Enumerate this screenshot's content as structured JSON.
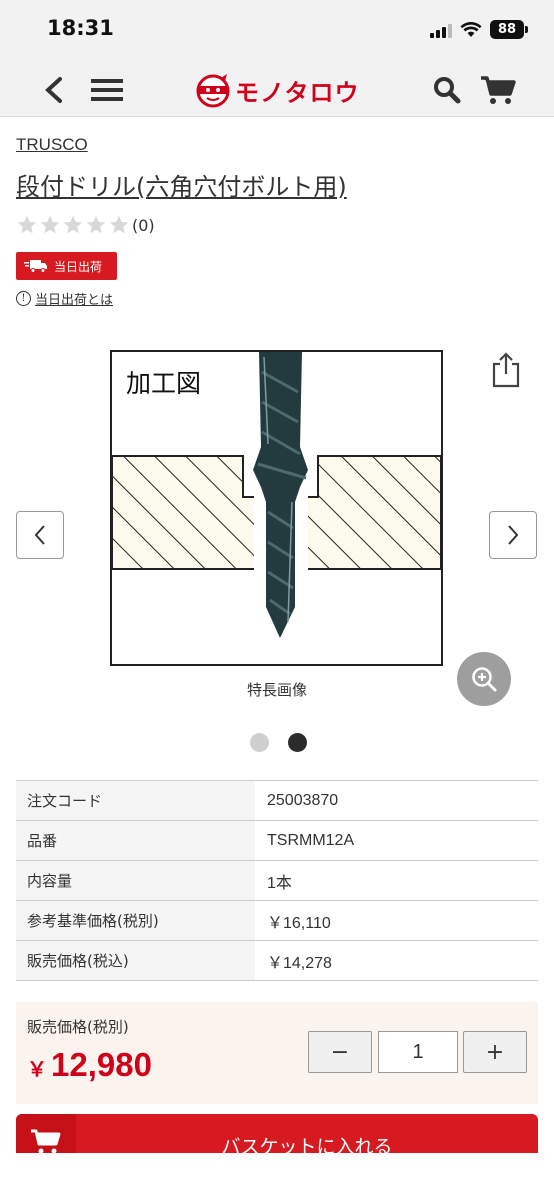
{
  "status_bar": {
    "time": "18:31",
    "battery": "88"
  },
  "header": {
    "logo_text": "モノタロウ",
    "back_icon": "back-icon",
    "menu_icon": "menu-icon",
    "search_icon": "search-icon",
    "cart_icon": "cart-icon"
  },
  "product": {
    "brand": "TRUSCO",
    "title": "段付ドリル(六角穴付ボルト用)",
    "rating_count": "(0)",
    "stars": 0,
    "badge": "当日出荷",
    "same_day_info": "当日出荷とは"
  },
  "gallery": {
    "figure_label": "加工図",
    "caption": "特長画像",
    "total": 2,
    "active_index": 1
  },
  "specs": [
    {
      "label": "注文コード",
      "value": "25003870"
    },
    {
      "label": "品番",
      "value": "TSRMM12A"
    },
    {
      "label": "内容量",
      "value": "1本"
    },
    {
      "label": "参考基準価格(税別)",
      "value": "￥16,110"
    },
    {
      "label": "販売価格(税込)",
      "value": "￥14,278"
    }
  ],
  "purchase": {
    "price_label": "販売価格(税別)",
    "yen": "￥",
    "price": "12,980",
    "quantity": "1",
    "minus": "−",
    "plus": "+",
    "add_to_cart": "バスケットに入れる"
  },
  "colors": {
    "brand_red": "#d71920",
    "price_box_bg": "#fbf3ee"
  }
}
